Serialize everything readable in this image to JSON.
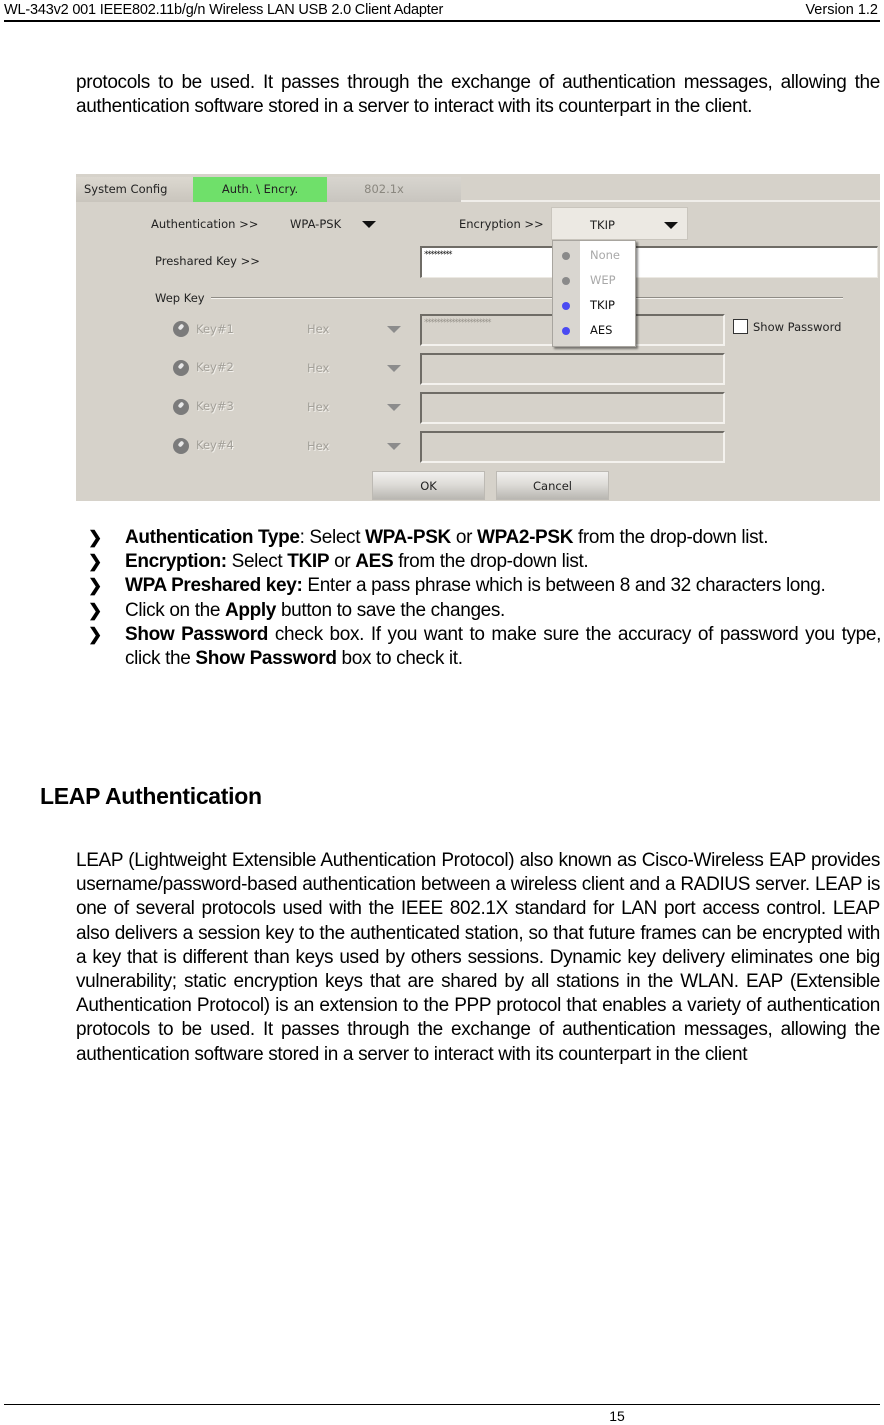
{
  "header": {
    "document_title": "WL-343v2 001 IEEE802.11b/g/n Wireless LAN USB 2.0 Client Adapter",
    "version": "Version 1.2"
  },
  "intro_paragraph": "protocols to be used. It passes through the exchange of authentication messages, allowing the authentication software stored in a server to interact with its counterpart in the client.",
  "dialog": {
    "tabs": [
      {
        "label": "System Config",
        "active": false
      },
      {
        "label": "Auth. \\ Encry.",
        "active": true
      },
      {
        "label": "802.1x",
        "active": false,
        "disabled": true
      }
    ],
    "authentication_label": "Authentication >>",
    "authentication_value": "WPA-PSK",
    "encryption_label": "Encryption >>",
    "encryption_value": "TKIP",
    "encryption_options": [
      {
        "label": "None",
        "enabled": false
      },
      {
        "label": "WEP",
        "enabled": false
      },
      {
        "label": "TKIP",
        "enabled": true
      },
      {
        "label": "AES",
        "enabled": true
      }
    ],
    "preshared_key_label": "Preshared Key >>",
    "preshared_key_value": "*********",
    "wep_key_group_label": "Wep Key",
    "wep_keys": [
      {
        "label": "Key#1",
        "format": "Hex",
        "value": "**********************"
      },
      {
        "label": "Key#2",
        "format": "Hex",
        "value": ""
      },
      {
        "label": "Key#3",
        "format": "Hex",
        "value": ""
      },
      {
        "label": "Key#4",
        "format": "Hex",
        "value": ""
      }
    ],
    "show_password_label": "Show Password",
    "show_password_checked": false,
    "ok_label": "OK",
    "cancel_label": "Cancel",
    "colors": {
      "active_tab": "#6fe06a",
      "panel_bg": "#d6d2ca",
      "option_dot_enabled": "#4a4af2",
      "option_dot_disabled": "#8a8a8a"
    }
  },
  "bullets": [
    {
      "arrow": "❯",
      "parts": [
        {
          "text": "Authentication Type",
          "bold": true
        },
        {
          "text": ": Select ",
          "bold": false
        },
        {
          "text": "WPA-PSK",
          "bold": true
        },
        {
          "text": " or ",
          "bold": false
        },
        {
          "text": "WPA2-PSK",
          "bold": true
        },
        {
          "text": " from the drop-down list.",
          "bold": false
        }
      ]
    },
    {
      "arrow": "❯",
      "parts": [
        {
          "text": "Encryption:",
          "bold": true
        },
        {
          "text": " Select ",
          "bold": false
        },
        {
          "text": "TKIP",
          "bold": true
        },
        {
          "text": " or ",
          "bold": false
        },
        {
          "text": "AES",
          "bold": true
        },
        {
          "text": " from the drop-down list.",
          "bold": false
        }
      ]
    },
    {
      "arrow": "❯",
      "parts": [
        {
          "text": "WPA Preshared key:",
          "bold": true
        },
        {
          "text": " Enter a pass phrase which is between 8 and 32 characters long.",
          "bold": false
        }
      ]
    },
    {
      "arrow": "❯",
      "parts": [
        {
          "text": "Click on the ",
          "bold": false
        },
        {
          "text": "Apply",
          "bold": true
        },
        {
          "text": " button to save the changes.",
          "bold": false
        }
      ]
    },
    {
      "arrow": "❯",
      "parts": [
        {
          "text": "Show Password",
          "bold": true
        },
        {
          "text": " check box. If you want to make sure the accuracy of password you type, click the ",
          "bold": false
        },
        {
          "text": "Show Password",
          "bold": true
        },
        {
          "text": " box to check it.",
          "bold": false
        }
      ]
    }
  ],
  "section": {
    "title": "LEAP Authentication",
    "paragraph": "LEAP (Lightweight Extensible Authentication Protocol) also known as Cisco-Wireless EAP provides username/password-based authentication between a wireless client and a RADIUS server.  LEAP is one of several protocols used with the IEEE 802.1X standard for LAN port access control. LEAP also delivers a session key to the authenticated station, so that future frames can be encrypted with a key that is different than keys used by others sessions. Dynamic key delivery eliminates one big vulnerability; static encryption keys that are shared by all stations in the WLAN. EAP (Extensible Authentication Protocol) is an extension to the PPP protocol that enables a variety of authentication protocols to be used. It passes through the exchange of authentication messages, allowing the authentication software stored in a server to interact with its counterpart in the client"
  },
  "footer": {
    "page_number": "15"
  }
}
